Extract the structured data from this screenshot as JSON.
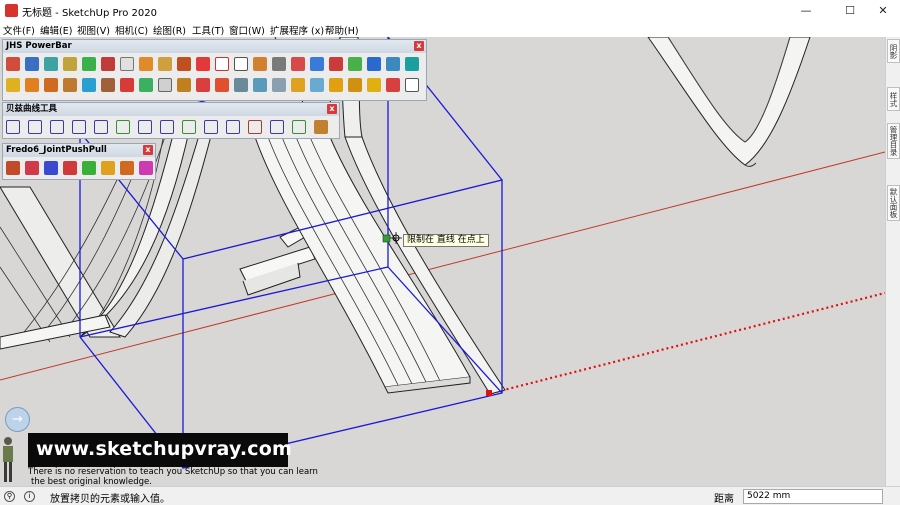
{
  "window": {
    "title": "无标题 - SketchUp Pro 2020",
    "minimize_glyph": "—",
    "maximize_glyph": "☐",
    "close_glyph": "✕"
  },
  "menu": [
    "文件(F)",
    "编辑(E)",
    "视图(V)",
    "相机(C)",
    "绘图(R)",
    "工具(T)",
    "窗口(W)",
    "扩展程序 (x)",
    "帮助(H)"
  ],
  "toolbars": {
    "jhs": {
      "title": "JHS PowerBar",
      "close": "x"
    },
    "bezier": {
      "title": "贝兹曲线工具",
      "close": "x"
    },
    "fredo": {
      "title": "Fredo6_JointPushPull",
      "close": "x"
    }
  },
  "tray_tabs": [
    "阴影",
    "样式",
    "管理目录",
    "默认面板"
  ],
  "tooltip": "限制在 直线 在点上",
  "watermark": {
    "url": "www.sketchupvray.com",
    "tagline": [
      "There is no reservation to teach you SketchUp so that you can learn",
      "the best original knowledge."
    ]
  },
  "statusbar": {
    "message": "放置拷贝的元素或输入值。",
    "measure_label": "距离",
    "measure_value": "5022 mm"
  },
  "colors": {
    "viewport_bg": "#d8d7d5",
    "selection_box": "#1a1ad6",
    "red_axis": "#c0392b",
    "inference_dotted": "#e01010"
  }
}
